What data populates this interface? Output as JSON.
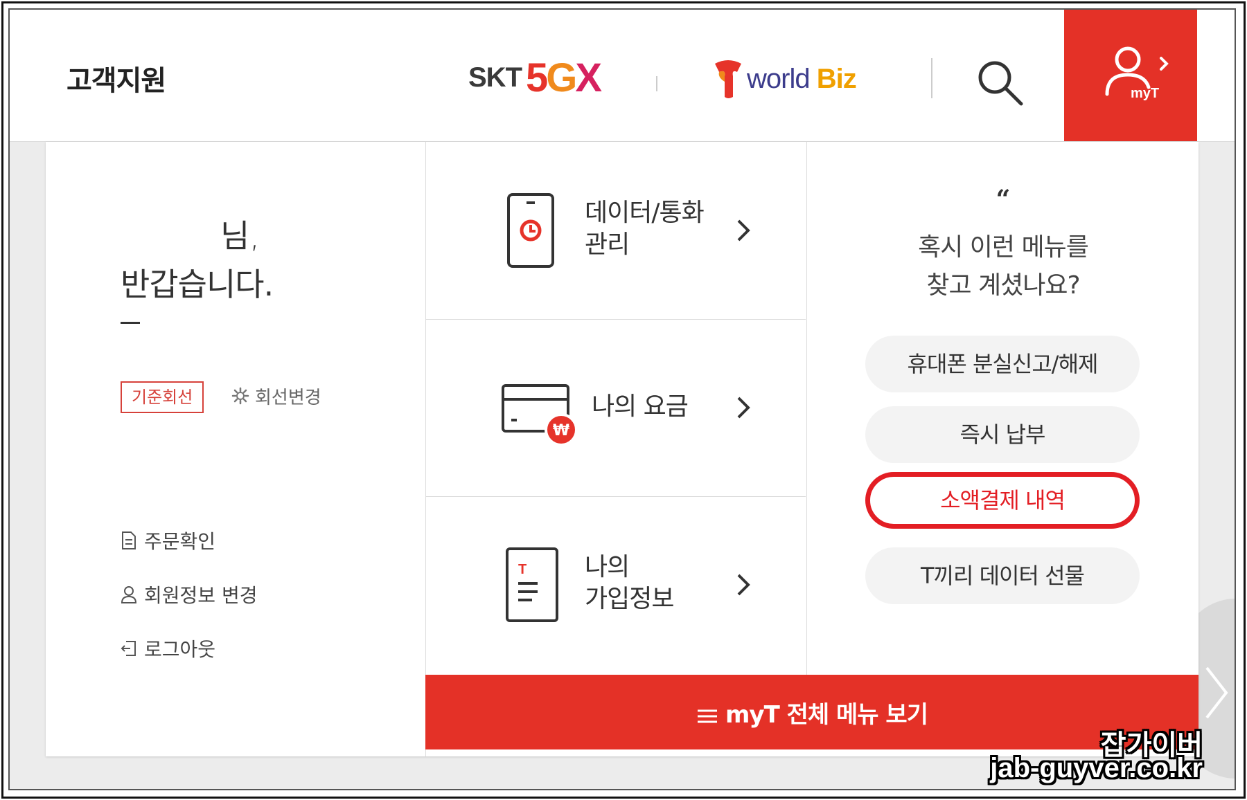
{
  "header": {
    "title": "고객지원",
    "brand_skt": "SKT",
    "brand_5gx_5": "5",
    "brand_5gx_g": "G",
    "brand_5gx_x": "X",
    "brand_world": "world",
    "brand_biz": "Biz",
    "myt_label": "myT"
  },
  "left": {
    "greet_name": "님,",
    "greet_hi": "반갑습니다.",
    "line_badge": "기준회선",
    "line_change": "회선변경",
    "links": [
      "주문확인",
      "회원정보 변경",
      "로그아웃"
    ]
  },
  "middle": {
    "items": [
      {
        "line1": "데이터/통화",
        "line2": "관리",
        "icon": "phone-clock-icon"
      },
      {
        "line1": "나의 요금",
        "line2": "",
        "icon": "card-won-icon"
      },
      {
        "line1": "나의",
        "line2": "가입정보",
        "icon": "document-t-icon"
      }
    ]
  },
  "right": {
    "quote": "“",
    "title_line1": "혹시 이런 메뉴를",
    "title_line2": "찾고 계셨나요?",
    "pills": [
      "휴대폰 분실신고/해제",
      "즉시 납부",
      "소액결제 내역",
      "T끼리 데이터 선물"
    ],
    "highlighted_index": 2
  },
  "bottom_bar": {
    "label": "myT 전체 메뉴 보기"
  },
  "watermark": {
    "line1": "잡가이버",
    "line2": "jab-guyver.co.kr"
  },
  "colors": {
    "accent_red": "#e43127",
    "highlight_red": "#e31e24",
    "backdrop": "#ececec"
  }
}
